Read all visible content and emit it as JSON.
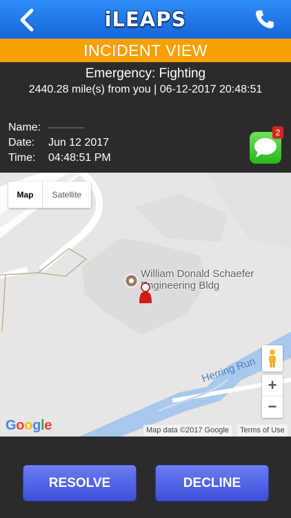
{
  "header": {
    "title": "iLEAPS",
    "back_icon": "chevron-left-icon",
    "call_icon": "phone-icon"
  },
  "banner": {
    "text": "INCIDENT VIEW",
    "color": "#f7a000"
  },
  "incident": {
    "emergency": "Emergency: Fighting",
    "distance_line": "2440.28 mile(s) from you | 06-12-2017 20:48:51",
    "name_label": "Name:",
    "date_label": "Date:",
    "date_value": "Jun 12 2017",
    "time_label": "Time:",
    "time_value": "04:48:51 PM"
  },
  "chat": {
    "icon": "message-bubble-icon",
    "badge_count": "2"
  },
  "map": {
    "type_options": [
      "Map",
      "Satellite"
    ],
    "selected_type": "Map",
    "place_label_line1": "William Donald Schaefer",
    "place_label_line2": "Engineering Bldg",
    "creek_label": "Herring Run",
    "zoom_in": "+",
    "zoom_out": "−",
    "logo": "Google",
    "attribution": "Map data ©2017 Google",
    "terms": "Terms of Use"
  },
  "actions": {
    "resolve_label": "RESOLVE",
    "decline_label": "DECLINE"
  },
  "colors": {
    "header_blue": "#1f78ea",
    "button_blue": "#4a5ee0",
    "dark_bg": "#2b2b2b"
  }
}
